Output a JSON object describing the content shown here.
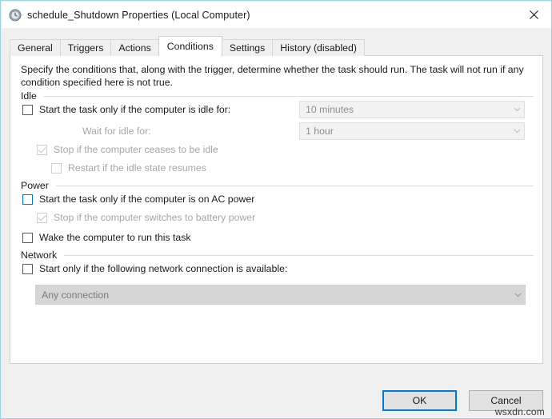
{
  "window": {
    "title": "schedule_Shutdown Properties (Local Computer)",
    "icon": "clock-icon",
    "close_label": "✕",
    "accent_color": "#0078d7",
    "border_color": "#9fd0dd"
  },
  "tabs": [
    {
      "label": "General",
      "selected": false
    },
    {
      "label": "Triggers",
      "selected": false
    },
    {
      "label": "Actions",
      "selected": false
    },
    {
      "label": "Conditions",
      "selected": true
    },
    {
      "label": "Settings",
      "selected": false
    },
    {
      "label": "History (disabled)",
      "selected": false
    }
  ],
  "page": {
    "description": "Specify the conditions that, along with the trigger, determine whether the task should run.  The task will not run  if any condition specified here is not true.",
    "groups": {
      "idle": {
        "title": "Idle",
        "start_if_idle": {
          "label": "Start the task only if the computer is idle for:",
          "checked": false,
          "enabled": true,
          "value": "10 minutes"
        },
        "wait_for_idle": {
          "label": "Wait for idle for:",
          "enabled": false,
          "value": "1 hour"
        },
        "stop_if_ceases_idle": {
          "label": "Stop if the computer ceases to be idle",
          "checked": true,
          "enabled": false
        },
        "restart_if_idle_resumes": {
          "label": "Restart if the idle state resumes",
          "checked": false,
          "enabled": false
        }
      },
      "power": {
        "title": "Power",
        "start_if_ac": {
          "label": "Start the task only if the computer is on AC power",
          "checked": false,
          "enabled": true,
          "focused": true
        },
        "stop_if_battery": {
          "label": "Stop if the computer switches to battery power",
          "checked": true,
          "enabled": false
        },
        "wake_computer": {
          "label": "Wake the computer to run this task",
          "checked": false,
          "enabled": true
        }
      },
      "network": {
        "title": "Network",
        "start_if_network": {
          "label": "Start only if the following network connection is available:",
          "checked": false,
          "enabled": true
        },
        "connection": {
          "value": "Any connection",
          "enabled": false
        }
      }
    }
  },
  "footer": {
    "ok_label": "OK",
    "cancel_label": "Cancel"
  },
  "watermark": "wsxdn.com"
}
